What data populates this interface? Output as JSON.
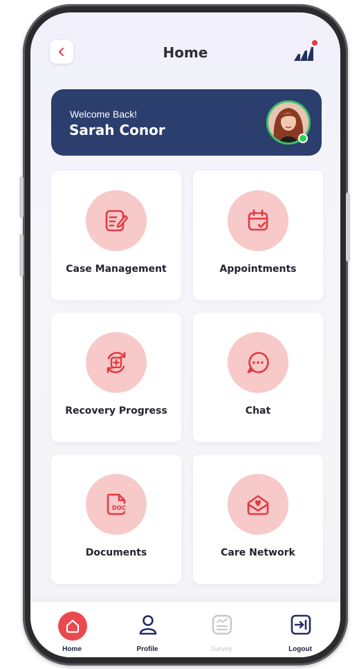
{
  "header": {
    "title": "Home"
  },
  "welcome": {
    "greeting": "Welcome Back!",
    "name": "Sarah Conor"
  },
  "tiles": [
    {
      "label": "Case Management",
      "icon": "edit-note-icon"
    },
    {
      "label": "Appointments",
      "icon": "calendar-check-icon"
    },
    {
      "label": "Recovery Progress",
      "icon": "recovery-cycle-icon"
    },
    {
      "label": "Chat",
      "icon": "chat-bubble-icon"
    },
    {
      "label": "Documents",
      "icon": "doc-file-icon",
      "icon_text": "DOC"
    },
    {
      "label": "Care Network",
      "icon": "heart-envelope-icon"
    }
  ],
  "nav": [
    {
      "label": "Home",
      "icon": "home-icon",
      "active": true
    },
    {
      "label": "Profile",
      "icon": "user-icon"
    },
    {
      "label": "Survey",
      "icon": "survey-icon",
      "disabled": true
    },
    {
      "label": "Logout",
      "icon": "logout-icon"
    }
  ],
  "colors": {
    "accent": "#ea4a4f",
    "icon_bg": "#f7c9c9",
    "welcome_bg": "#2b3e6d",
    "online": "#2ecc5b"
  }
}
